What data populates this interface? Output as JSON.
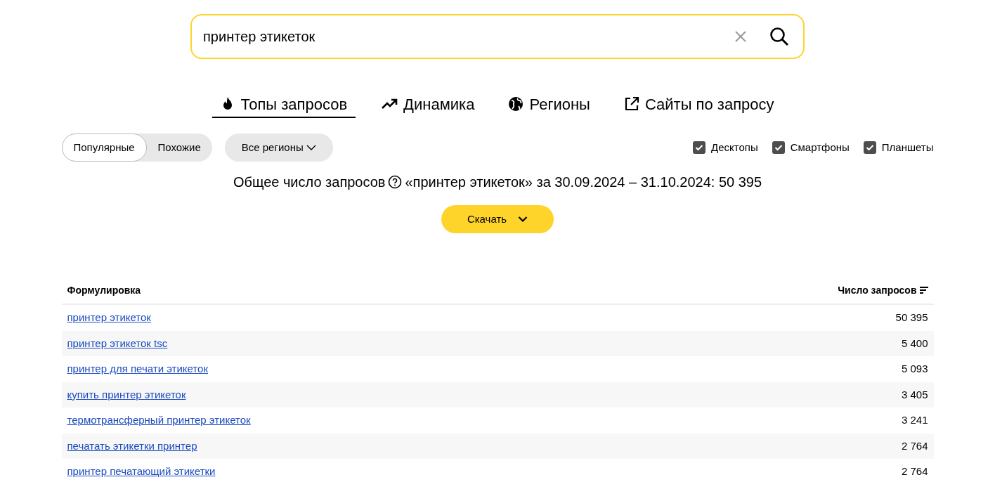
{
  "search": {
    "value": "принтер этикеток"
  },
  "tabs": [
    {
      "label": "Топы запросов",
      "kind": "fire",
      "selected": true
    },
    {
      "label": "Динамика",
      "kind": "trend",
      "selected": false
    },
    {
      "label": "Регионы",
      "kind": "globe",
      "selected": false
    },
    {
      "label": "Сайты по запросу",
      "kind": "external",
      "selected": false
    }
  ],
  "mode_switch": [
    {
      "label": "Популярные",
      "selected": true
    },
    {
      "label": "Похожие",
      "selected": false
    }
  ],
  "region_dropdown": {
    "label": "Все регионы"
  },
  "devices": [
    {
      "label": "Десктопы",
      "checked": true
    },
    {
      "label": "Смартфоны",
      "checked": true
    },
    {
      "label": "Планшеты",
      "checked": true
    }
  ],
  "total": {
    "label": "Общее число запросов",
    "text": "«принтер этикеток» за 30.09.2024 – 31.10.2024: 50 395"
  },
  "download_button": {
    "label": "Скачать"
  },
  "table": {
    "columns": [
      "Формулировка",
      "Число запросов"
    ],
    "rows": [
      {
        "phrase": "принтер этикеток",
        "count": "50 395"
      },
      {
        "phrase": "принтер этикеток tsc",
        "count": "5 400"
      },
      {
        "phrase": "принтер для печати этикеток",
        "count": "5 093"
      },
      {
        "phrase": "купить принтер этикеток",
        "count": "3 405"
      },
      {
        "phrase": "термотрансферный принтер этикеток",
        "count": "3 241"
      },
      {
        "phrase": "печатать этикетки принтер",
        "count": "2 764"
      },
      {
        "phrase": "принтер печатающий этикетки",
        "count": "2 764"
      }
    ]
  }
}
